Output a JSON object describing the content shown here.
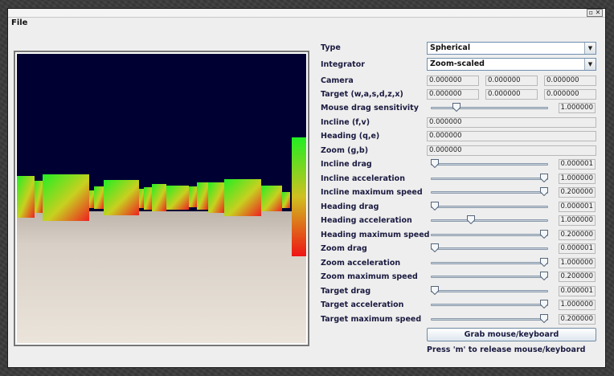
{
  "menu": {
    "file": "File"
  },
  "window_controls": "▫ ✕",
  "form": {
    "type": {
      "label": "Type",
      "value": "Spherical"
    },
    "integrator": {
      "label": "Integrator",
      "value": "Zoom-scaled"
    },
    "camera": {
      "label": "Camera",
      "values": [
        "0.000000",
        "0.000000",
        "0.000000"
      ]
    },
    "target": {
      "label": "Target (w,a,s,d,z,x)",
      "values": [
        "0.000000",
        "0.000000",
        "0.000000"
      ]
    },
    "mouse_drag_sensitivity": {
      "label": "Mouse drag sensitivity",
      "value": "1.000000",
      "level": 0.2
    },
    "incline": {
      "label": "Incline (f,v)",
      "value": "0.000000"
    },
    "heading": {
      "label": "Heading (q,e)",
      "value": "0.000000"
    },
    "zoom": {
      "label": "Zoom (g,b)",
      "value": "0.000000"
    },
    "sliders": [
      {
        "label": "Incline drag",
        "value": "0.000001",
        "level": 0.0
      },
      {
        "label": "Incline acceleration",
        "value": "1.000000",
        "level": 1.0
      },
      {
        "label": "Incline maximum speed",
        "value": "0.200000",
        "level": 1.0
      },
      {
        "label": "Heading drag",
        "value": "0.000001",
        "level": 0.0
      },
      {
        "label": "Heading acceleration",
        "value": "1.000000",
        "level": 0.33
      },
      {
        "label": "Heading maximum speed",
        "value": "0.200000",
        "level": 1.0
      },
      {
        "label": "Zoom drag",
        "value": "0.000001",
        "level": 0.0
      },
      {
        "label": "Zoom acceleration",
        "value": "1.000000",
        "level": 1.0
      },
      {
        "label": "Zoom maximum speed",
        "value": "0.200000",
        "level": 1.0
      },
      {
        "label": "Target drag",
        "value": "0.000001",
        "level": 0.0
      },
      {
        "label": "Target acceleration",
        "value": "1.000000",
        "level": 1.0
      },
      {
        "label": "Target maximum speed",
        "value": "0.200000",
        "level": 1.0
      }
    ],
    "grab_button": "Grab mouse/keyboard",
    "hint": "Press 'm' to release mouse/keyboard"
  },
  "colors": {
    "sky": "#000033",
    "ground": "#e4ddd4",
    "accent": "#6e8fb0",
    "label": "#1a1a40"
  }
}
